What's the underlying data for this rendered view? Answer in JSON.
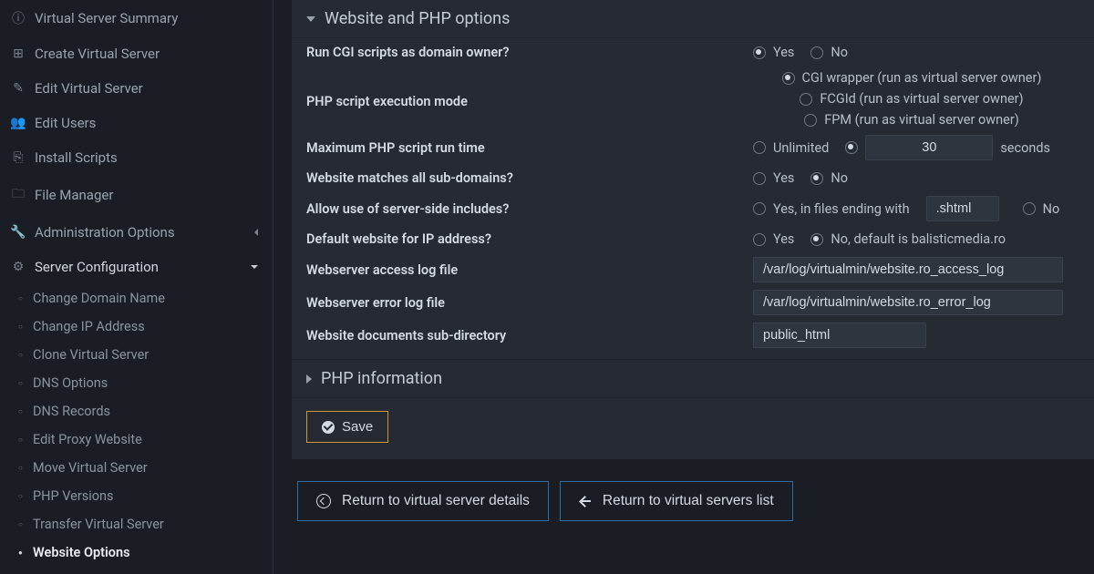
{
  "sidebar": {
    "items": [
      {
        "label": "Virtual Server Summary"
      },
      {
        "label": "Create Virtual Server"
      },
      {
        "label": "Edit Virtual Server"
      },
      {
        "label": "Edit Users"
      },
      {
        "label": "Install Scripts"
      },
      {
        "label": "File Manager"
      },
      {
        "label": "Administration Options"
      },
      {
        "label": "Server Configuration"
      }
    ],
    "serverConfig": [
      {
        "label": "Change Domain Name"
      },
      {
        "label": "Change IP Address"
      },
      {
        "label": "Clone Virtual Server"
      },
      {
        "label": "DNS Options"
      },
      {
        "label": "DNS Records"
      },
      {
        "label": "Edit Proxy Website"
      },
      {
        "label": "Move Virtual Server"
      },
      {
        "label": "PHP Versions"
      },
      {
        "label": "Transfer Virtual Server"
      },
      {
        "label": "Website Options"
      }
    ]
  },
  "panel": {
    "sectionTitle": "Website and PHP options",
    "phpInfoTitle": "PHP information",
    "labels": {
      "runCgi": "Run CGI scripts as domain owner?",
      "phpMode": "PHP script execution mode",
      "maxRun": "Maximum PHP script run time",
      "matchSub": "Website matches all sub-domains?",
      "ssi": "Allow use of server-side includes?",
      "defaultIp": "Default website for IP address?",
      "accessLog": "Webserver access log file",
      "errorLog": "Webserver error log file",
      "docSub": "Website documents sub-directory"
    },
    "values": {
      "yes": "Yes",
      "no": "No",
      "cgiWrapper": "CGI wrapper (run as virtual server owner)",
      "fcgid": "FCGId (run as virtual server owner)",
      "fpm": "FPM (run as virtual server owner)",
      "unlimited": "Unlimited",
      "maxRunSeconds": "30",
      "seconds": "seconds",
      "ssiYesPrefix": "Yes, in files ending with",
      "ssiExt": ".shtml",
      "defaultIpNo": "No, default is balisticmedia.ro",
      "accessLog": "/var/log/virtualmin/website.ro_access_log",
      "errorLog": "/var/log/virtualmin/website.ro_error_log",
      "docSub": "public_html"
    },
    "saveLabel": "Save"
  },
  "bottom": {
    "returnDetails": "Return to virtual server details",
    "returnList": "Return to virtual servers list"
  }
}
